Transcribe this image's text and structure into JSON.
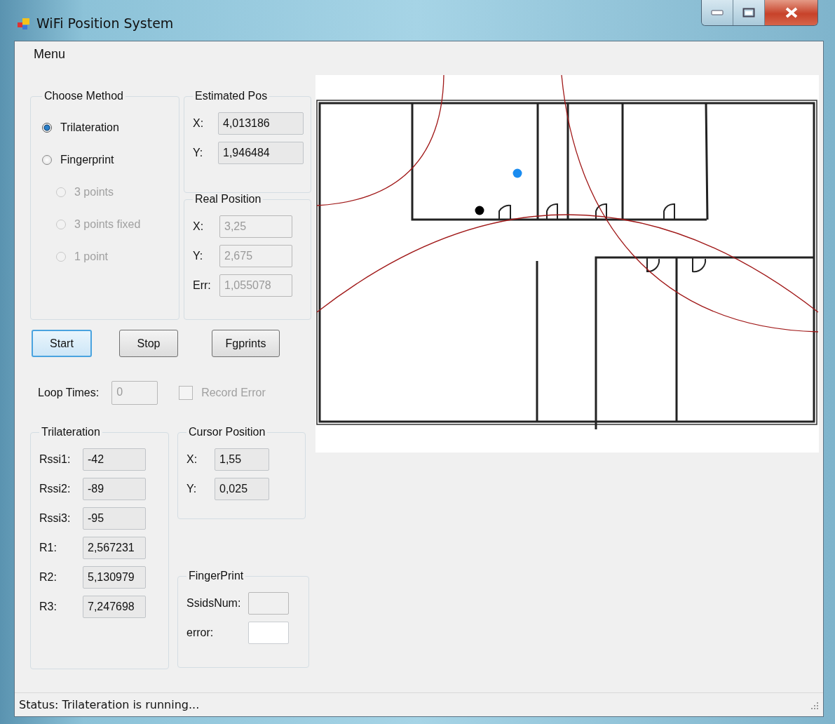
{
  "window": {
    "title": "WiFi Position System"
  },
  "menu": [
    "Menu"
  ],
  "method_group": {
    "title": "Choose Method",
    "options": [
      {
        "label": "Trilateration",
        "selected": true,
        "disabled": false,
        "indent": false
      },
      {
        "label": "Fingerprint",
        "selected": false,
        "disabled": false,
        "indent": false
      },
      {
        "label": "3 points",
        "selected": false,
        "disabled": true,
        "indent": true
      },
      {
        "label": "3 points fixed",
        "selected": false,
        "disabled": true,
        "indent": true
      },
      {
        "label": "1 point",
        "selected": false,
        "disabled": true,
        "indent": true
      }
    ]
  },
  "estimated_pos": {
    "title": "Estimated Pos",
    "fields": [
      {
        "label": "X:",
        "value": "4,013186",
        "kind": "readonly"
      },
      {
        "label": "Y:",
        "value": "1,946484",
        "kind": "readonly"
      }
    ]
  },
  "real_position": {
    "title": "Real Position",
    "fields": [
      {
        "label": "X:",
        "value": "3,25",
        "kind": "disabled"
      },
      {
        "label": "Y:",
        "value": "2,675",
        "kind": "disabled"
      },
      {
        "label": "Err:",
        "value": "1,055078",
        "kind": "disabled"
      }
    ]
  },
  "buttons": [
    {
      "label": "Start",
      "focused": true
    },
    {
      "label": "Stop",
      "focused": false
    },
    {
      "label": "Fgprints",
      "focused": false
    }
  ],
  "loop_times": {
    "label": "Loop Times:",
    "value": "0",
    "kind": "disabled"
  },
  "record_error": {
    "label": "Record Error",
    "checked": false,
    "disabled": true
  },
  "trilateration": {
    "title": "Trilateration",
    "fields": [
      {
        "label": "Rssi1:",
        "value": "-42",
        "kind": "readonly"
      },
      {
        "label": "Rssi2:",
        "value": "-89",
        "kind": "readonly"
      },
      {
        "label": "Rssi3:",
        "value": "-95",
        "kind": "readonly"
      },
      {
        "label": "R1:",
        "value": "2,567231",
        "kind": "readonly"
      },
      {
        "label": "R2:",
        "value": "5,130979",
        "kind": "readonly"
      },
      {
        "label": "R3:",
        "value": "7,247698",
        "kind": "readonly"
      }
    ]
  },
  "cursor_position": {
    "title": "Cursor Position",
    "fields": [
      {
        "label": "X:",
        "value": "1,55",
        "kind": "readonly"
      },
      {
        "label": "Y:",
        "value": "0,025",
        "kind": "readonly"
      }
    ]
  },
  "fingerprint": {
    "title": "FingerPrint",
    "fields": [
      {
        "label": "SsidsNum:",
        "kind": "disabled"
      },
      {
        "label": "error:",
        "kind": "input"
      }
    ]
  },
  "status": "Status: Trilateration is running..."
}
